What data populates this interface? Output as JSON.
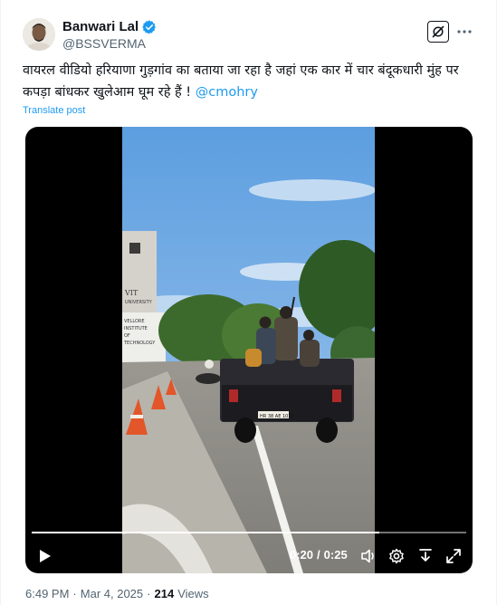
{
  "author": {
    "name": "Banwari Lal",
    "handle": "@BSSVERMA",
    "verified": true,
    "avatar_icon": "avatar-photo"
  },
  "header": {
    "grok_icon": "grok-icon",
    "more_icon": "more-icon"
  },
  "tweet": {
    "text": "वायरल वीडियो हरियाणा गुड़गांव का बताया जा रहा है जहां एक कार में चार बंदूकधारी मुंह पर कपड़ा बांधकर खुलेआम घूम रहे हैं !",
    "mention": "@cmohry",
    "translate_label": "Translate post"
  },
  "video": {
    "current_time": "0:20",
    "separator": "/",
    "duration": "0:25",
    "progress_fraction": 0.8,
    "building_sign": "VELLORE INSTITUTE OF TECHNOLOGY",
    "building_logo": "VIT UNIVERSITY",
    "license_plate": "HR 38 AE 1010"
  },
  "meta": {
    "time": "6:49 PM",
    "dot": "·",
    "date": "Mar 4, 2025",
    "dot2": "·",
    "views_count": "214",
    "views_label": "Views"
  },
  "colors": {
    "accent": "#1d9bf0",
    "text": "#0f1419",
    "muted": "#536471"
  }
}
